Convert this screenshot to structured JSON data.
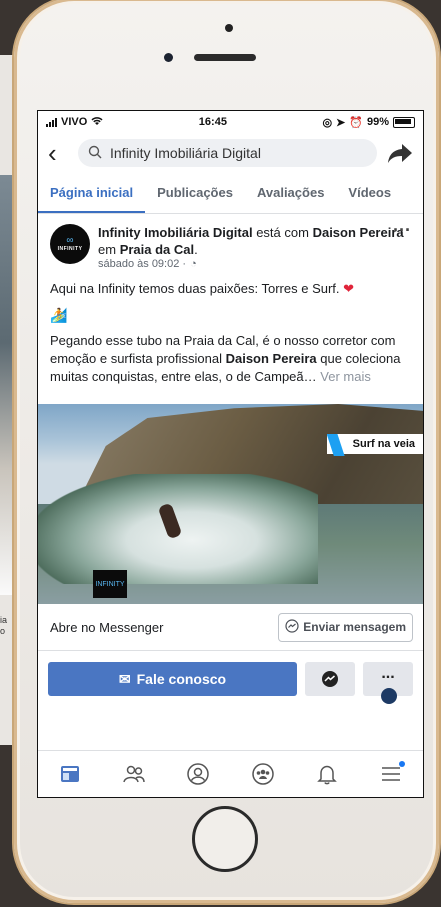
{
  "status_bar": {
    "carrier": "VIVO",
    "time": "16:45",
    "battery": "99%"
  },
  "search": {
    "query": "Infinity Imobiliária Digital"
  },
  "tabs": [
    {
      "label": "Página inicial",
      "active": true
    },
    {
      "label": "Publicações"
    },
    {
      "label": "Avaliações"
    },
    {
      "label": "Vídeos"
    }
  ],
  "post": {
    "avatar_text": "INFINITY",
    "author": "Infinity Imobiliária Digital",
    "with_text": "está com",
    "tagged": "Daison Pereira",
    "place_text": "em",
    "place": "Praia da Cal",
    "time": "sábado às 09:02 ·",
    "line1": "Aqui na Infinity temos duas paixões: Torres e Surf.",
    "para2_start": "Pegando esse tubo na Praia da Cal, é o nosso corretor com emoção e surfista profissional ",
    "para2_bold": "Daison Pereira",
    "para2_end": " que coleciona muitas conquistas, entre elas, o de Campeã…",
    "ver_mais": "Ver mais",
    "photo_badge": "Surf na veia",
    "photo_logo": "INFINITY"
  },
  "messenger": {
    "label": "Abre no Messenger",
    "button": "Enviar mensagem"
  },
  "actions": {
    "primary": "Fale conosco",
    "more": "..."
  },
  "nav": [
    "home-icon",
    "friends-icon",
    "profile-icon",
    "groups-icon",
    "bell-icon",
    "menu-icon"
  ],
  "left_peek": {
    "line1": "ia",
    "line2": "o"
  },
  "colors": {
    "accent": "#4a76c2",
    "tab_active": "#3b6fc1",
    "heart": "#e0243a"
  }
}
